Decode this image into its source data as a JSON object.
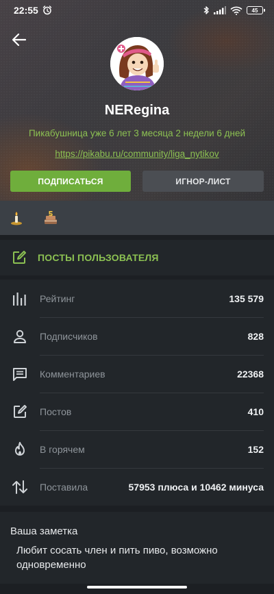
{
  "status_bar": {
    "time": "22:55",
    "battery": "45",
    "icons": [
      "alarm-icon",
      "bluetooth-icon",
      "signal-icon",
      "wifi-icon",
      "battery-icon"
    ]
  },
  "profile": {
    "username": "NERegina",
    "tenure": "Пикабушница уже 6 лет 3 месяца 2 недели 6 дней",
    "link": "https://pikabu.ru/community/liga_nytikov",
    "subscribe_label": "ПОДПИСАТЬСЯ",
    "ignore_label": "ИГНОР-ЛИСТ"
  },
  "awards": [
    "candle-award-icon",
    "cake-5-award-icon"
  ],
  "posts": {
    "label": "ПОСТЫ ПОЛЬЗОВАТЕЛЯ"
  },
  "stats": [
    {
      "label": "Рейтинг",
      "value": "135 579",
      "icon": "bar-chart-icon"
    },
    {
      "label": "Подписчиков",
      "value": "828",
      "icon": "person-icon"
    },
    {
      "label": "Комментариев",
      "value": "22368",
      "icon": "comment-icon"
    },
    {
      "label": "Постов",
      "value": "410",
      "icon": "edit-icon"
    },
    {
      "label": "В горячем",
      "value": "152",
      "icon": "flame-icon"
    },
    {
      "label": "Поставила",
      "value": "57953 плюса и 10462 минуса",
      "icon": "up-down-arrows-icon"
    }
  ],
  "note": {
    "title": "Ваша заметка",
    "text": "Любит сосать член и пить пиво, возможно одновременно"
  },
  "colors": {
    "accent": "#8cc152",
    "subscribe_bg": "#6fae3c",
    "background": "#1c1f23",
    "card": "#22262a"
  }
}
